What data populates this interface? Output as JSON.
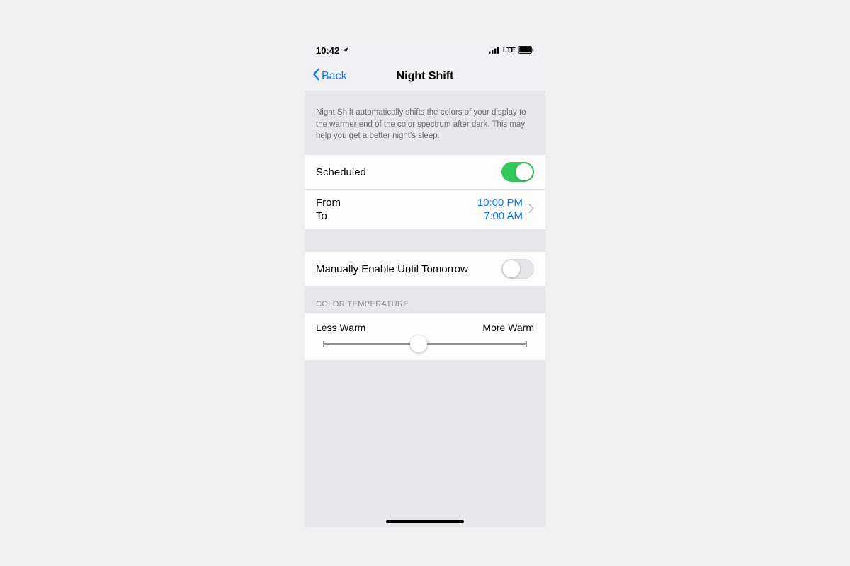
{
  "status_bar": {
    "time": "10:42",
    "network": "LTE"
  },
  "nav": {
    "back_label": "Back",
    "title": "Night Shift"
  },
  "description": "Night Shift automatically shifts the colors of your display to the warmer end of the color spectrum after dark. This may help you get a better night's sleep.",
  "scheduled": {
    "label": "Scheduled",
    "enabled": true
  },
  "schedule_times": {
    "from_label": "From",
    "from_value": "10:00 PM",
    "to_label": "To",
    "to_value": "7:00 AM"
  },
  "manual": {
    "label": "Manually Enable Until Tomorrow",
    "enabled": false
  },
  "temperature": {
    "header": "COLOR TEMPERATURE",
    "min_label": "Less Warm",
    "max_label": "More Warm",
    "value_percent": 47
  }
}
